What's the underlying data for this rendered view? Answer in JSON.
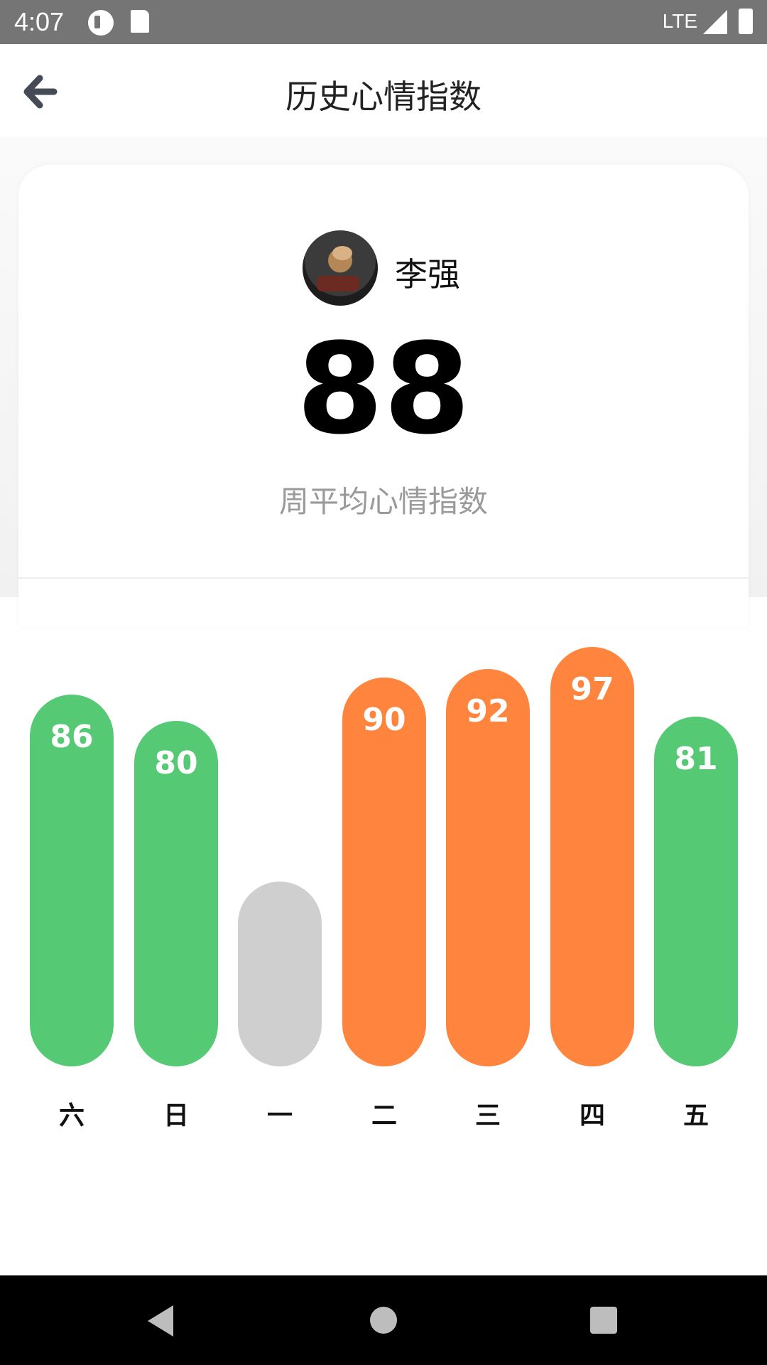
{
  "status_bar": {
    "time": "4:07",
    "network": "LTE",
    "icons": [
      "notification-app-icon",
      "sd-card-icon",
      "signal-icon",
      "battery-icon"
    ]
  },
  "header": {
    "title": "历史心情指数",
    "back_icon": "arrow-left-icon"
  },
  "profile": {
    "name": "李强",
    "avatar_icon": "user-avatar"
  },
  "summary": {
    "score": "88",
    "label": "周平均心情指数"
  },
  "colors": {
    "good": "#55c974",
    "high": "#ff843d",
    "empty": "#cfcfcf"
  },
  "chart_data": {
    "type": "bar",
    "categories": [
      "六",
      "日",
      "一",
      "二",
      "三",
      "四",
      "五"
    ],
    "values": [
      86,
      80,
      null,
      90,
      92,
      97,
      81
    ],
    "value_labels": [
      "86",
      "80",
      "",
      "90",
      "92",
      "97",
      "81"
    ],
    "bar_colors": [
      "#55c974",
      "#55c974",
      "#cfcfcf",
      "#ff843d",
      "#ff843d",
      "#ff843d",
      "#55c974"
    ],
    "title": "",
    "xlabel": "",
    "ylabel": ""
  },
  "nav_bar": {
    "icons": [
      "back-triangle-icon",
      "home-circle-icon",
      "recents-square-icon"
    ]
  }
}
